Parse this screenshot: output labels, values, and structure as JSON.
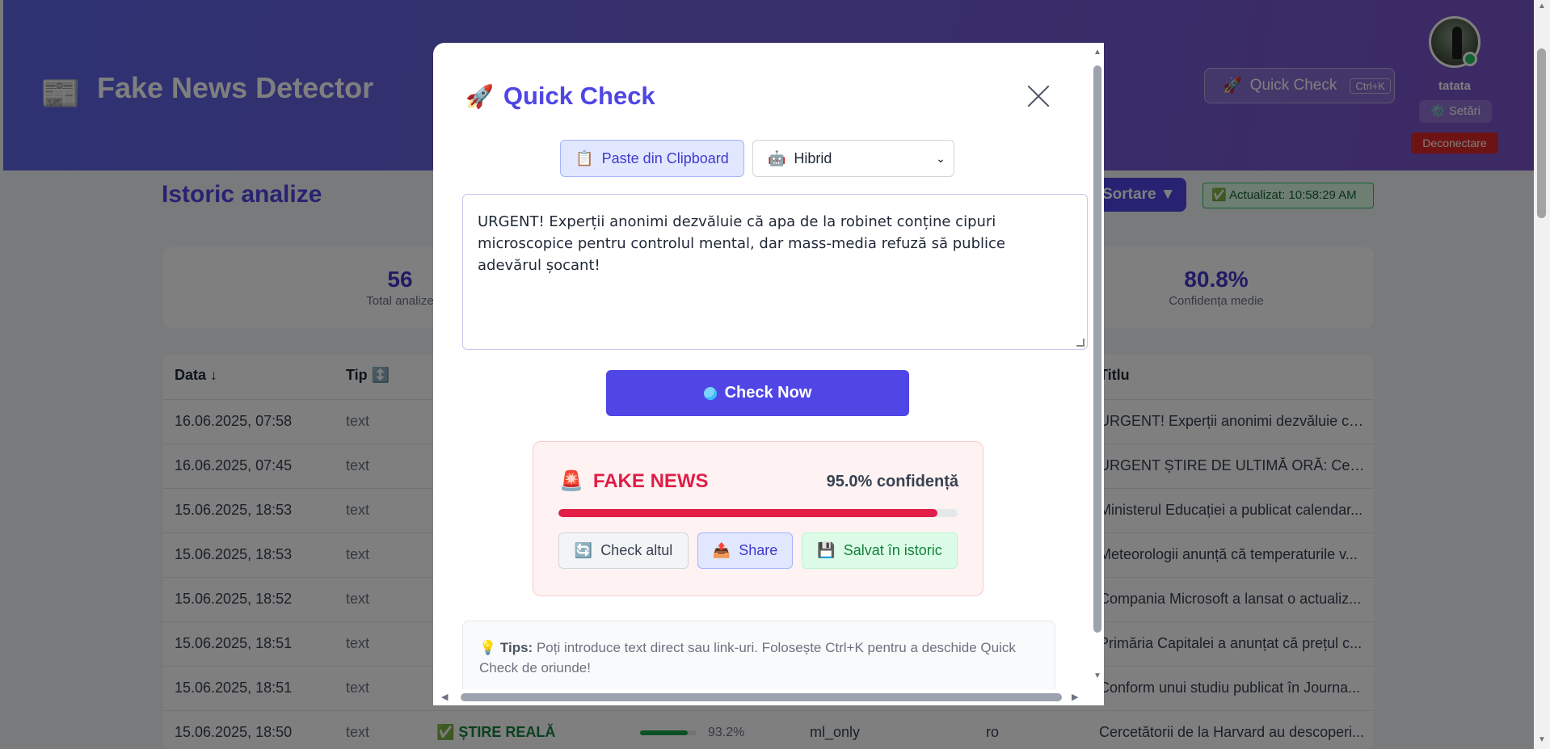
{
  "header": {
    "app_title": "Fake News Detector",
    "logo_icon": "newspaper-icon",
    "quick_check_label": "Quick Check",
    "quick_check_shortcut": "Ctrl+K",
    "username": "tatata",
    "settings_label": "⚙️ Setări",
    "logout_label": "Deconectare"
  },
  "history": {
    "title": "Istoric analize",
    "sort_label": "Sortare ▼",
    "updated_label": "Actualizat: 10:58:29 AM",
    "stats": [
      {
        "value": "56",
        "label": "Total analize"
      },
      {
        "value": "80.8%",
        "label": "Confidența medie"
      }
    ],
    "columns": {
      "date": "Data ↓",
      "type": "Tip ↕️",
      "title": "Titlu"
    },
    "rows": [
      {
        "date": "16.06.2025, 07:58",
        "type": "text",
        "title": "URGENT! Experții anonimi dezvăluie că ..."
      },
      {
        "date": "16.06.2025, 07:45",
        "type": "text",
        "title": "URGENT ȘTIRE DE ULTIMĂ ORĂ: Cercet..."
      },
      {
        "date": "15.06.2025, 18:53",
        "type": "text",
        "title": "Ministerul Educației a publicat calendar..."
      },
      {
        "date": "15.06.2025, 18:53",
        "type": "text",
        "title": "Meteorologii anunță că temperaturile v..."
      },
      {
        "date": "15.06.2025, 18:52",
        "type": "text",
        "title": "Compania Microsoft a lansat o actualiz..."
      },
      {
        "date": "15.06.2025, 18:51",
        "type": "text",
        "title": "Primăria Capitalei a anunțat că prețul c..."
      },
      {
        "date": "15.06.2025, 18:51",
        "type": "text",
        "title": "Conform unui studiu publicat în Journa..."
      },
      {
        "date": "15.06.2025, 18:50",
        "type": "text",
        "verdict": "ȘTIRE REALĂ",
        "confidence": "93.2%",
        "confidence_value": 0.932,
        "method": "ml_only",
        "lang": "ro",
        "title": "Cercetătorii de la Harvard au descoperi..."
      }
    ]
  },
  "modal": {
    "title": "Quick Check",
    "title_icon": "rocket-icon",
    "paste_label": "Paste din Clipboard",
    "mode_selected": "Hibrid",
    "input_text": "URGENT! Experții anonimi dezvăluie că apa de la robinet conține cipuri microscopice pentru controlul mental, dar mass-media refuză să publice adevărul șocant!",
    "check_label": "Check Now",
    "result": {
      "verdict": "FAKE NEWS",
      "confidence_text": "95.0% confidență",
      "confidence_value": 0.95,
      "check_again_label": "Check altul",
      "share_label": "Share",
      "saved_label": "Salvat în istoric"
    },
    "tips_label": "Tips:",
    "tips_text": "Poți introduce text direct sau link-uri. Folosește Ctrl+K pentru a deschide Quick Check de oriunde!"
  },
  "colors": {
    "accent": "#4f46e5",
    "fake": "#e11d48",
    "real": "#16a34a"
  }
}
